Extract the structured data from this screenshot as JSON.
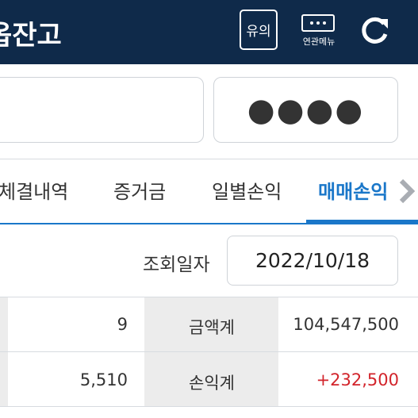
{
  "header": {
    "title": "옵잔고",
    "caution_label": "유의",
    "related_menu_label": "연관메뉴",
    "icons": {
      "related": "more-dots-icon",
      "refresh": "refresh-icon"
    },
    "colors": {
      "background": "#0f2a4a",
      "foreground": "#ffffff"
    }
  },
  "account": {
    "password_mask": "●●●●"
  },
  "tabs": {
    "items": [
      {
        "label": "체결내역"
      },
      {
        "label": "증거금"
      },
      {
        "label": "일별손익"
      },
      {
        "label": "매매손익"
      }
    ],
    "active_index": 3,
    "active_color": "#1a77c9",
    "scroll_icon": "chevron-right-icon"
  },
  "query": {
    "date_label": "조회일자",
    "date_value": "2022/10/18"
  },
  "summary": {
    "rows": [
      {
        "left_value": "9",
        "label": "금액계",
        "right_value": "104,547,500"
      },
      {
        "left_value": "5,510",
        "label": "손익계",
        "right_value": "+232,500"
      }
    ],
    "profit_color": "#d2232a"
  }
}
